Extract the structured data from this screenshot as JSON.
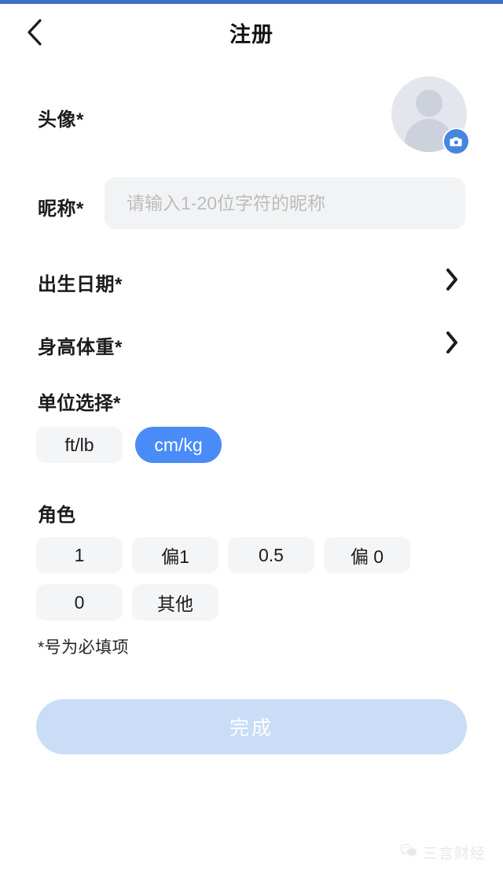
{
  "theme": {
    "status_bar_color": "#3d6fc4",
    "accent_color": "#4a8cf7",
    "accent_disabled_color": "#c9ddf6",
    "pill_bg_color": "#f4f5f7",
    "input_bg_color": "#f2f3f5",
    "text_color": "#1b1b1b",
    "placeholder_color": "#bcbcbc"
  },
  "navbar": {
    "title": "注册",
    "back_icon": "chevron-left-icon"
  },
  "form": {
    "avatar": {
      "label": "头像*",
      "avatar_icon": "person-placeholder-icon",
      "camera_badge_icon": "camera-icon"
    },
    "nickname": {
      "label": "昵称*",
      "placeholder": "请输入1-20位字符的昵称",
      "value": ""
    },
    "birthdate": {
      "label": "出生日期*",
      "chevron_icon": "chevron-right-icon",
      "value": ""
    },
    "height_weight": {
      "label": "身高体重*",
      "chevron_icon": "chevron-right-icon",
      "value": ""
    },
    "unit": {
      "label": "单位选择*",
      "options": [
        {
          "label": "ft/lb",
          "selected": false
        },
        {
          "label": "cm/kg",
          "selected": true
        }
      ]
    },
    "role": {
      "label": "角色",
      "options": [
        {
          "label": "1",
          "selected": false
        },
        {
          "label": "偏1",
          "selected": false
        },
        {
          "label": "0.5",
          "selected": false
        },
        {
          "label": "偏 0",
          "selected": false
        },
        {
          "label": "0",
          "selected": false
        },
        {
          "label": "其他",
          "selected": false
        }
      ]
    },
    "required_note": "*号为必填项",
    "submit": {
      "label": "完成",
      "enabled": false
    }
  },
  "watermark": {
    "icon": "wechat-icon",
    "text": "三言财经"
  }
}
